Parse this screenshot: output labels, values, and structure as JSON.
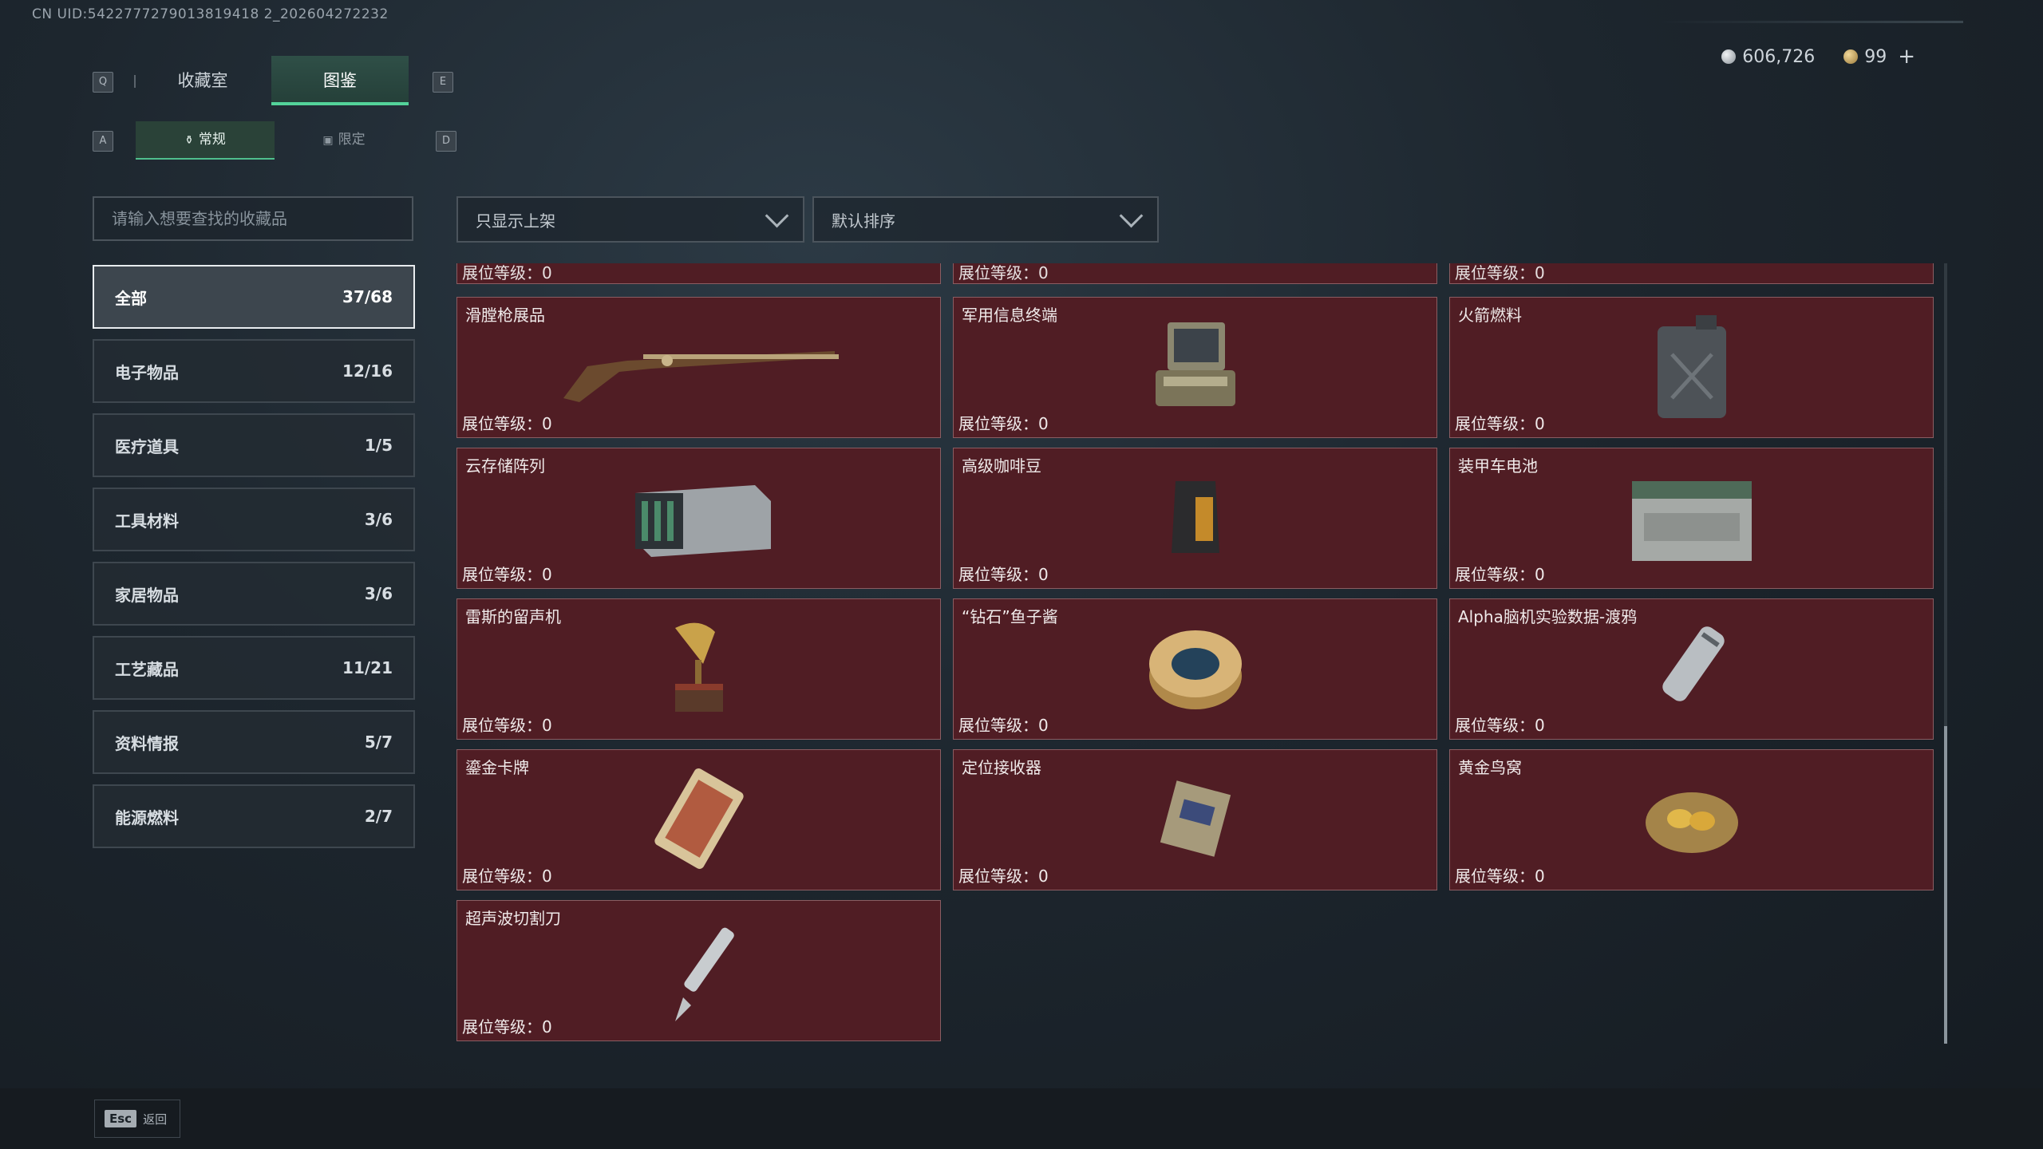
{
  "uid": "CN UID:5422777279013819418 2_202604272232",
  "currency": {
    "silver": "606,726",
    "gold": "99",
    "plus": "+"
  },
  "keys": {
    "q": "Q",
    "e": "E",
    "a": "A",
    "d": "D"
  },
  "tabs": [
    {
      "label": "收藏室"
    },
    {
      "label": "图鉴"
    }
  ],
  "subtabs": [
    {
      "label": "常规"
    },
    {
      "label": "限定"
    }
  ],
  "search": {
    "placeholder": "请输入想要查找的收藏品"
  },
  "filters": {
    "display": "只显示上架",
    "sort": "默认排序"
  },
  "categories": [
    {
      "label": "全部",
      "count": "37/68"
    },
    {
      "label": "电子物品",
      "count": "12/16"
    },
    {
      "label": "医疗道具",
      "count": "1/5"
    },
    {
      "label": "工具材料",
      "count": "3/6"
    },
    {
      "label": "家居物品",
      "count": "3/6"
    },
    {
      "label": "工艺藏品",
      "count": "11/21"
    },
    {
      "label": "资料情报",
      "count": "5/7"
    },
    {
      "label": "能源燃料",
      "count": "2/7"
    }
  ],
  "level_label": "展位等级：0",
  "items": [
    {
      "name": "滑膛枪展品",
      "icon": "musket-icon"
    },
    {
      "name": "军用信息终端",
      "icon": "military-terminal-icon"
    },
    {
      "name": "火箭燃料",
      "icon": "fuel-canister-icon"
    },
    {
      "name": "云存储阵列",
      "icon": "storage-array-icon"
    },
    {
      "name": "高级咖啡豆",
      "icon": "coffee-bag-icon"
    },
    {
      "name": "装甲车电池",
      "icon": "vehicle-battery-icon"
    },
    {
      "name": "雷斯的留声机",
      "icon": "gramophone-icon"
    },
    {
      "name": "“钻石”鱼子酱",
      "icon": "caviar-tin-icon"
    },
    {
      "name": "Alpha脑机实验数据-渡鸦",
      "icon": "data-canister-icon"
    },
    {
      "name": "鎏金卡牌",
      "icon": "gilded-card-icon"
    },
    {
      "name": "定位接收器",
      "icon": "locator-receiver-icon"
    },
    {
      "name": "黄金鸟窝",
      "icon": "golden-nest-icon"
    },
    {
      "name": "超声波切割刀",
      "icon": "ultrasonic-knife-icon"
    }
  ],
  "footer": {
    "esc_key": "Esc",
    "esc_label": "返回"
  }
}
